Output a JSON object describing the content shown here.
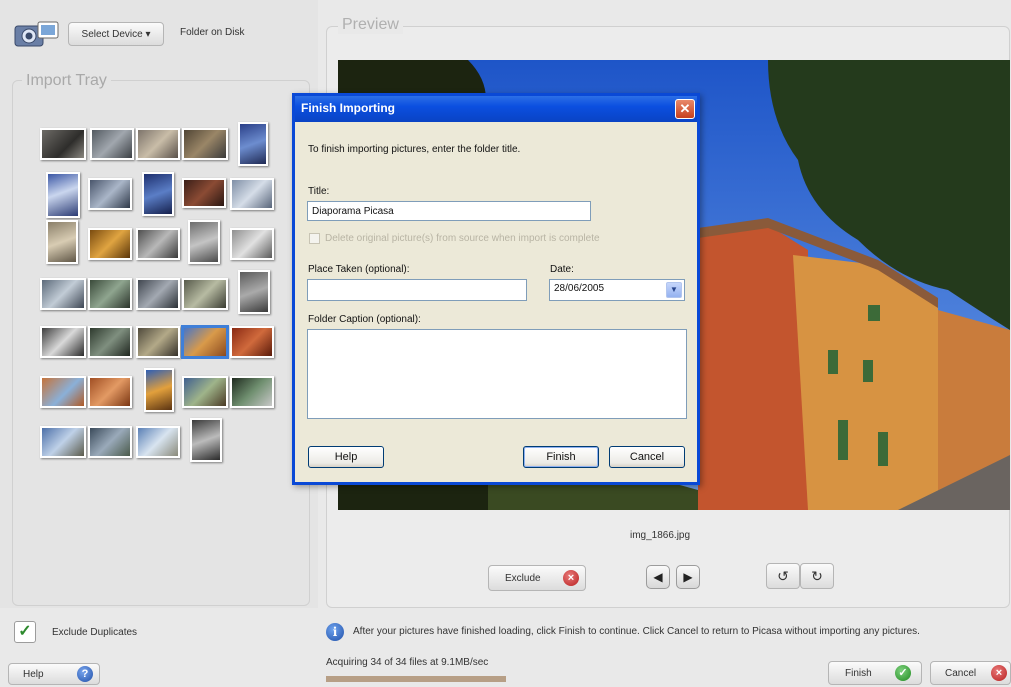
{
  "toolbar": {
    "select_device_label": "Select Device ▾",
    "folder_on_disk_label": "Folder on Disk"
  },
  "import_tray": {
    "label": "Import Tray"
  },
  "preview": {
    "label": "Preview",
    "file_name": "img_1866.jpg",
    "exclude_label": "Exclude"
  },
  "dialog": {
    "title": "Finish Importing",
    "close_glyph": "✕",
    "instructions": "To finish importing pictures, enter the folder title.",
    "title_label": "Title:",
    "title_value": "Diaporama Picasa",
    "delete_originals_label": "Delete original picture(s) from source when import is complete",
    "place_taken_label": "Place Taken (optional):",
    "place_taken_value": "",
    "date_label": "Date:",
    "date_value": "28/06/2005",
    "folder_caption_label": "Folder Caption (optional):",
    "folder_caption_value": "",
    "help_label": "Help",
    "finish_label": "Finish",
    "cancel_label": "Cancel"
  },
  "bottom": {
    "exclude_duplicates_label": "Exclude Duplicates",
    "info_message": "After your pictures have finished loading, click Finish to continue. Click Cancel to return to Picasa without importing any pictures.",
    "acquire_status": "Acquiring 34 of 34 files at 9.1MB/sec",
    "progress": 1.0,
    "help_label": "Help",
    "finish_label": "Finish",
    "cancel_label": "Cancel"
  },
  "colors": {
    "dialog_border": "#0a49d6",
    "selected_thumb_border": "#3f7fd8",
    "progress_fill": "#b79f86"
  },
  "icons": [
    "camera-icon",
    "info-icon",
    "check-icon",
    "help-icon",
    "x-circle-icon",
    "arrow-left-icon",
    "arrow-right-icon",
    "rotate-left-icon",
    "rotate-right-icon",
    "close-icon",
    "chevron-down-icon"
  ]
}
